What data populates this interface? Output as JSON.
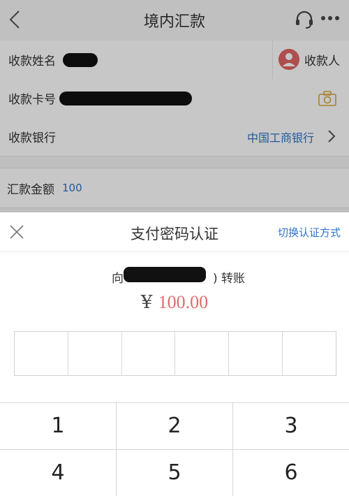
{
  "header": {
    "title": "境内汇款"
  },
  "form": {
    "payee_name_label": "收款姓名",
    "payee_button_label": "收款人",
    "card_label": "收款卡号",
    "bank_label": "收款银行",
    "bank_value": "中国工商银行",
    "amount_label": "汇款金额",
    "amount_value": "100"
  },
  "dialog": {
    "title": "支付密码认证",
    "switch_label": "切换认证方式",
    "transfer_prefix": "向",
    "transfer_suffix": ") 转账",
    "currency": "¥",
    "amount": "100.00",
    "pin_length": 6
  },
  "keypad": {
    "row1": [
      "1",
      "2",
      "3"
    ],
    "row2": [
      "4",
      "5",
      "6"
    ]
  },
  "colors": {
    "accent": "#2d73c8",
    "amount": "#e06c6c",
    "avatar": "#e06464"
  },
  "icons": [
    "back-icon",
    "customer-service-icon",
    "more-icon",
    "avatar-icon",
    "camera-icon",
    "chevron-right-icon",
    "close-icon"
  ]
}
